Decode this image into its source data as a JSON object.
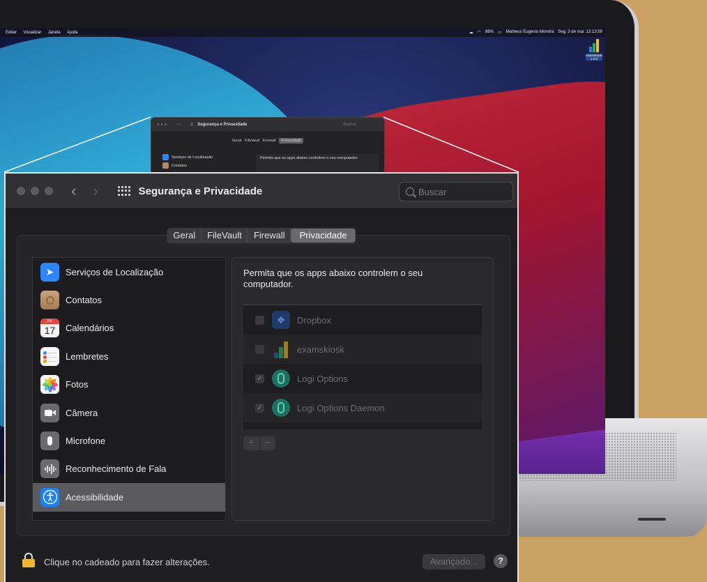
{
  "menubar": {
    "menus": [
      "Editar",
      "Visualizar",
      "Janela",
      "Ajuda"
    ],
    "battery": "88%",
    "user": "Matheus Eugenio Moreira",
    "clock": "Seg. 3 de mai.  12:13:59"
  },
  "desktop_icon": {
    "label": "examskiosk",
    "version": "1.0.0"
  },
  "mini": {
    "title": "Segurança e Privacidade",
    "search_placeholder": "Buscar",
    "tabs": [
      "Geral",
      "FileVault",
      "Firewall",
      "Privacidade"
    ],
    "items": [
      "Serviços de Localização",
      "Contatos"
    ],
    "desc": "Permita que os apps abaixo controlem o seu computador."
  },
  "window": {
    "title": "Segurança e Privacidade",
    "search_placeholder": "Buscar",
    "nav_back": "‹",
    "nav_forward": "›"
  },
  "tabs": [
    {
      "label": "Geral"
    },
    {
      "label": "FileVault"
    },
    {
      "label": "Firewall"
    },
    {
      "label": "Privacidade",
      "selected": true
    }
  ],
  "sidebar": [
    {
      "label": "Serviços de Localização",
      "icon": "location-icon"
    },
    {
      "label": "Contatos",
      "icon": "contacts-icon"
    },
    {
      "label": "Calendários",
      "icon": "calendar-icon",
      "month": "JUL",
      "day": "17"
    },
    {
      "label": "Lembretes",
      "icon": "reminders-icon"
    },
    {
      "label": "Fotos",
      "icon": "photos-icon"
    },
    {
      "label": "Câmera",
      "icon": "camera-icon"
    },
    {
      "label": "Microfone",
      "icon": "microphone-icon"
    },
    {
      "label": "Reconhecimento de Fala",
      "icon": "speech-recognition-icon"
    },
    {
      "label": "Acessibilidade",
      "icon": "accessibility-icon",
      "selected": true
    }
  ],
  "pane": {
    "description": "Permita que os apps abaixo controlem o seu computador.",
    "apps": [
      {
        "name": "Dropbox",
        "checked": false,
        "icon": "dropbox-icon"
      },
      {
        "name": "examskiosk",
        "checked": false,
        "icon": "examskiosk-icon"
      },
      {
        "name": "Logi Options",
        "checked": true,
        "icon": "logi-options-icon"
      },
      {
        "name": "Logi Options Daemon",
        "checked": true,
        "icon": "logi-options-daemon-icon"
      }
    ],
    "add_label": "+",
    "remove_label": "−"
  },
  "footer": {
    "lock_text": "Clique no cadeado para fazer alterações.",
    "advanced_label": "Avançado...",
    "help_label": "?"
  },
  "colors": {
    "selection": "#5b5b5e",
    "accent_blue": "#2d86ff",
    "lock_yellow": "#f0b52c",
    "background": "#c9a263"
  }
}
